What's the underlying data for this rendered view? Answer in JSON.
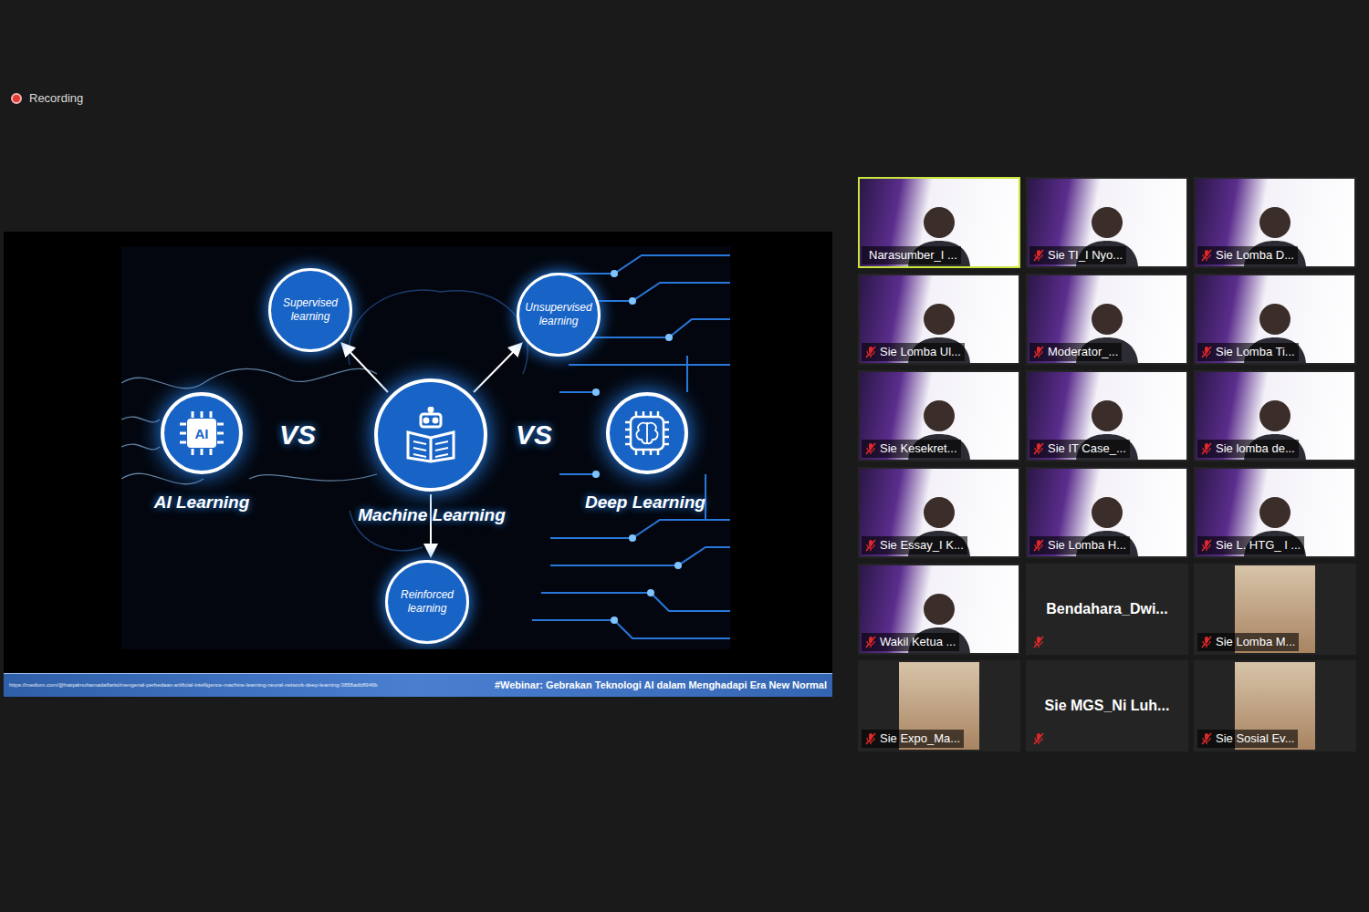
{
  "recording": {
    "label": "Recording"
  },
  "shared_screen": {
    "diagram": {
      "nodes": [
        {
          "label": "Supervised learning",
          "kind": "small"
        },
        {
          "label": "Unsupervised learning",
          "kind": "small"
        },
        {
          "label": "Reinforced learning",
          "kind": "small"
        },
        {
          "label": "AI Learning",
          "kind": "ai",
          "icon_text": "AI"
        },
        {
          "label": "Machine Learning",
          "kind": "ml"
        },
        {
          "label": "Deep Learning",
          "kind": "dl"
        }
      ],
      "vs": [
        "VS",
        "VS"
      ]
    },
    "footer": {
      "url": "https://medium.com/@haiqalmuhamadalfarisi/mengenal-perbedaan-artificial-intelligence-machine-learning-neural-network-deep-learning-3858adb8946b",
      "caption": "#Webinar: Gebrakan Teknologi AI dalam Menghadapi Era New Normal"
    }
  },
  "participants": [
    {
      "name": "Narasumber_I ...",
      "kind": "video",
      "muted": false,
      "selected": true
    },
    {
      "name": "Sie TI_I Nyo...",
      "kind": "video",
      "muted": true,
      "selected": false
    },
    {
      "name": "Sie Lomba D...",
      "kind": "video",
      "muted": true,
      "selected": false
    },
    {
      "name": "Sie Lomba Ul...",
      "kind": "video",
      "muted": true,
      "selected": false
    },
    {
      "name": "Moderator_...",
      "kind": "video",
      "muted": true,
      "selected": false
    },
    {
      "name": "Sie Lomba Ti...",
      "kind": "video",
      "muted": true,
      "selected": false
    },
    {
      "name": "Sie Kesekret...",
      "kind": "video",
      "muted": true,
      "selected": false
    },
    {
      "name": "Sie IT Case_...",
      "kind": "video",
      "muted": true,
      "selected": false
    },
    {
      "name": "Sie lomba de...",
      "kind": "video",
      "muted": true,
      "selected": false
    },
    {
      "name": "Sie Essay_I K...",
      "kind": "video",
      "muted": true,
      "selected": false
    },
    {
      "name": "Sie Lomba H...",
      "kind": "video",
      "muted": true,
      "selected": false
    },
    {
      "name": "Sie L. HTG_ I ...",
      "kind": "video",
      "muted": true,
      "selected": false
    },
    {
      "name": "Wakil Ketua ...",
      "kind": "video",
      "muted": true,
      "selected": false
    },
    {
      "name": "Bendahara_Dwi...",
      "kind": "name",
      "muted": true,
      "selected": false
    },
    {
      "name": "Sie Lomba M...",
      "kind": "avatar",
      "muted": true,
      "selected": false
    },
    {
      "name": "Sie Expo_Ma...",
      "kind": "avatar",
      "muted": true,
      "selected": false
    },
    {
      "name": "Sie MGS_Ni Luh...",
      "kind": "name",
      "muted": true,
      "selected": false
    },
    {
      "name": "Sie Sosial Ev...",
      "kind": "avatar",
      "muted": true,
      "selected": false
    }
  ]
}
